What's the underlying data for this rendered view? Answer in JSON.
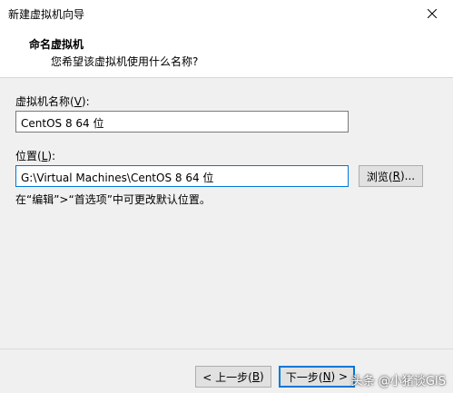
{
  "window": {
    "title": "新建虚拟机向导",
    "close_icon": "close-icon"
  },
  "header": {
    "title": "命名虚拟机",
    "subtitle": "您希望该虚拟机使用什么名称?"
  },
  "form": {
    "name_label_prefix": "虚拟机名称(",
    "name_label_key": "V",
    "name_label_suffix": "):",
    "name_value": "CentOS 8 64 位",
    "location_label_prefix": "位置(",
    "location_label_key": "L",
    "location_label_suffix": "):",
    "location_value": "G:\\Virtual Machines\\CentOS 8 64 位",
    "browse_prefix": "浏览(",
    "browse_key": "R",
    "browse_suffix": ")...",
    "hint": "在“编辑”>“首选项”中可更改默认位置。"
  },
  "footer": {
    "back_prefix": "< 上一步(",
    "back_key": "B",
    "back_suffix": ")",
    "next_prefix": "下一步(",
    "next_key": "N",
    "next_suffix": ") >"
  },
  "watermark": "头条 @小猪谈GIS"
}
